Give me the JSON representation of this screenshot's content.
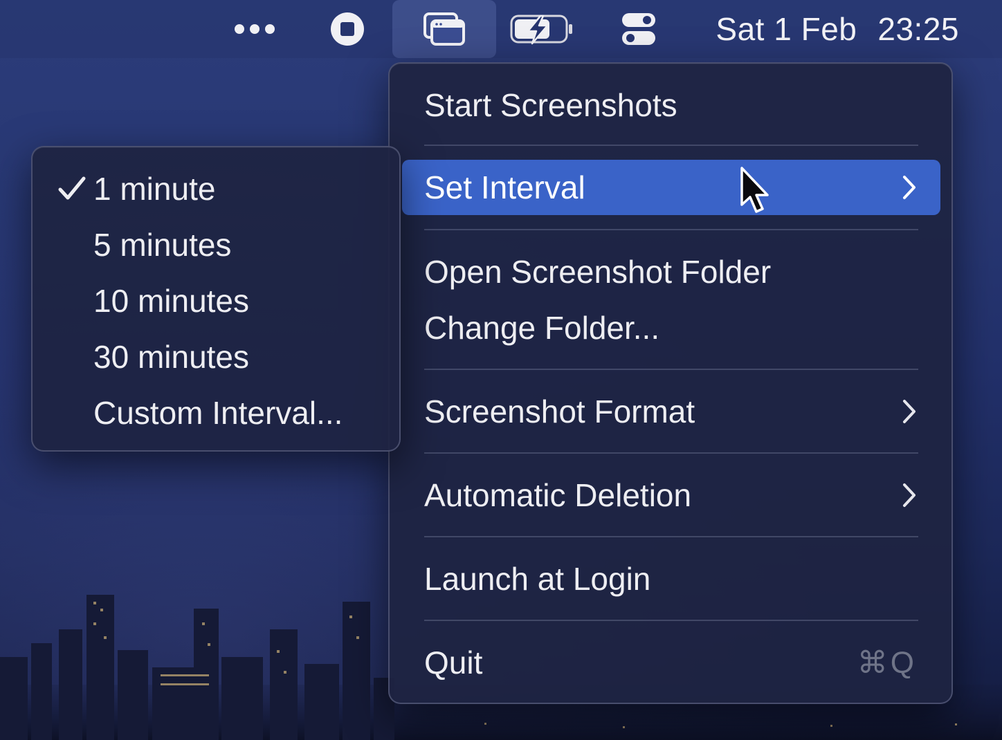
{
  "menubar": {
    "icons": [
      "more-dots-icon",
      "stop-record-icon",
      "screenshot-app-icon",
      "battery-charging-icon",
      "control-center-icon"
    ],
    "date": "Sat 1 Feb",
    "time": "23:25"
  },
  "main_menu": {
    "items": [
      {
        "label": "Start Screenshots"
      },
      {
        "label": "Set Interval",
        "highlighted": true,
        "submenu": true
      },
      {
        "label": "Open Screenshot Folder"
      },
      {
        "label": "Change Folder..."
      },
      {
        "label": "Screenshot Format",
        "submenu": true
      },
      {
        "label": "Automatic Deletion",
        "submenu": true
      },
      {
        "label": "Launch at Login"
      },
      {
        "label": "Quit",
        "shortcut": "⌘Q"
      }
    ]
  },
  "interval_submenu": {
    "items": [
      {
        "label": "1 minute",
        "checked": true
      },
      {
        "label": "5 minutes"
      },
      {
        "label": "10 minutes"
      },
      {
        "label": "30 minutes"
      },
      {
        "label": "Custom Interval..."
      }
    ]
  },
  "colors": {
    "highlight": "#3a63c8",
    "menu_bg": "#1e2442",
    "wallpaper_top": "#2c3c7a"
  }
}
